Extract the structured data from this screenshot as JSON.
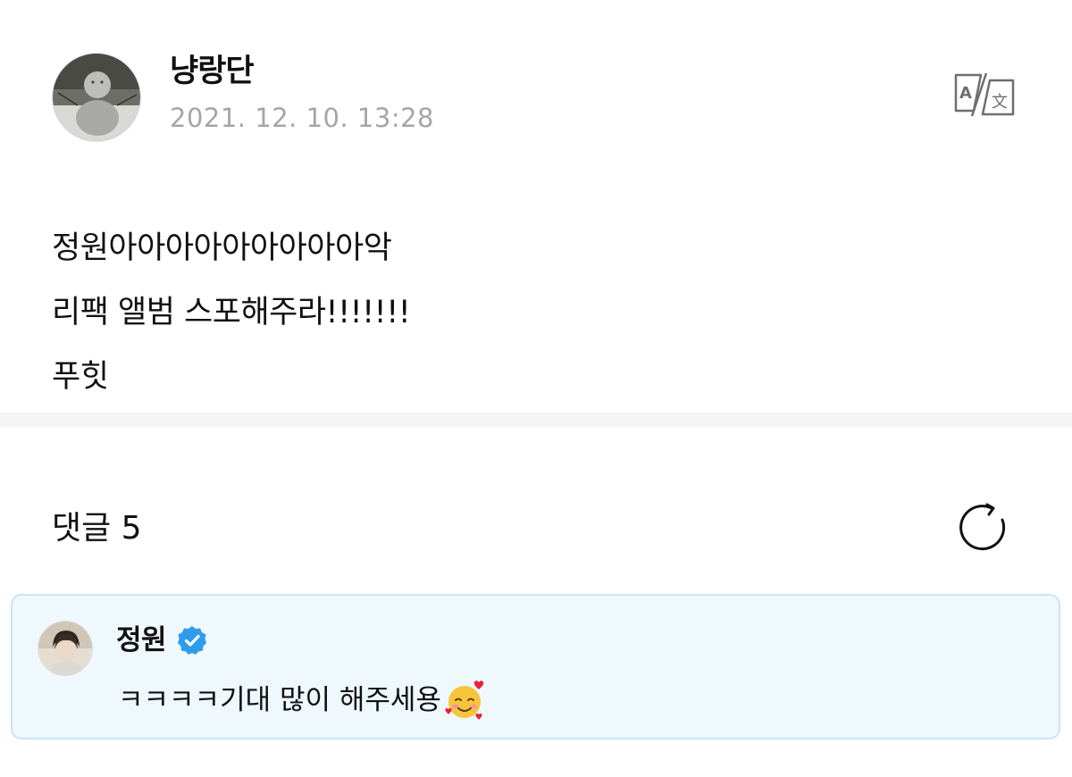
{
  "post": {
    "author": "냥랑단",
    "timestamp": "2021. 12. 10. 13:28",
    "body_lines": [
      "정원아아아아아아아아아악",
      "리팩 앨범 스포해주라!!!!!!!",
      "푸힛"
    ],
    "translate_icon": "translate-icon",
    "avatar_icon": "snowman-avatar"
  },
  "comments": {
    "header": "댓글 5",
    "refresh_icon": "refresh-icon",
    "items": [
      {
        "author": "정원",
        "verified": true,
        "verified_icon": "verified-badge-icon",
        "text": "ㅋㅋㅋㅋ기대 많이 해주세용",
        "emoji": "smiling-face-with-hearts-emoji"
      }
    ]
  },
  "colors": {
    "timestamp": "#a6a6a6",
    "divider": "#f4f5f7",
    "highlight_bg": "#eef8fd",
    "highlight_border": "#c8e6f4",
    "verified": "#2f9bec"
  }
}
